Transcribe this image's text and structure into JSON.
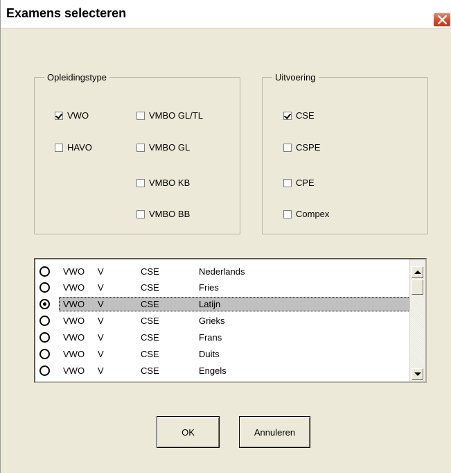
{
  "window": {
    "title": "Examens selecteren",
    "close_icon": "close-icon"
  },
  "opleidingstype": {
    "legend": "Opleidingstype",
    "options": [
      {
        "label": "VWO",
        "checked": true
      },
      {
        "label": "HAVO",
        "checked": false
      },
      {
        "label": "VMBO GL/TL",
        "checked": false
      },
      {
        "label": "VMBO GL",
        "checked": false
      },
      {
        "label": "VMBO KB",
        "checked": false
      },
      {
        "label": "VMBO BB",
        "checked": false
      }
    ]
  },
  "uitvoering": {
    "legend": "Uitvoering",
    "options": [
      {
        "label": "CSE",
        "checked": true
      },
      {
        "label": "CSPE",
        "checked": false
      },
      {
        "label": "CPE",
        "checked": false
      },
      {
        "label": "Compex",
        "checked": false
      }
    ]
  },
  "exams": {
    "rows": [
      {
        "type": "VWO",
        "level": "V",
        "exam": "CSE",
        "subject": "Nederlands",
        "selected": false
      },
      {
        "type": "VWO",
        "level": "V",
        "exam": "CSE",
        "subject": "Fries",
        "selected": false
      },
      {
        "type": "VWO",
        "level": "V",
        "exam": "CSE",
        "subject": "Latijn",
        "selected": true
      },
      {
        "type": "VWO",
        "level": "V",
        "exam": "CSE",
        "subject": "Grieks",
        "selected": false
      },
      {
        "type": "VWO",
        "level": "V",
        "exam": "CSE",
        "subject": "Frans",
        "selected": false
      },
      {
        "type": "VWO",
        "level": "V",
        "exam": "CSE",
        "subject": "Duits",
        "selected": false
      },
      {
        "type": "VWO",
        "level": "V",
        "exam": "CSE",
        "subject": "Engels",
        "selected": false
      }
    ]
  },
  "buttons": {
    "ok": "OK",
    "cancel": "Annuleren"
  }
}
